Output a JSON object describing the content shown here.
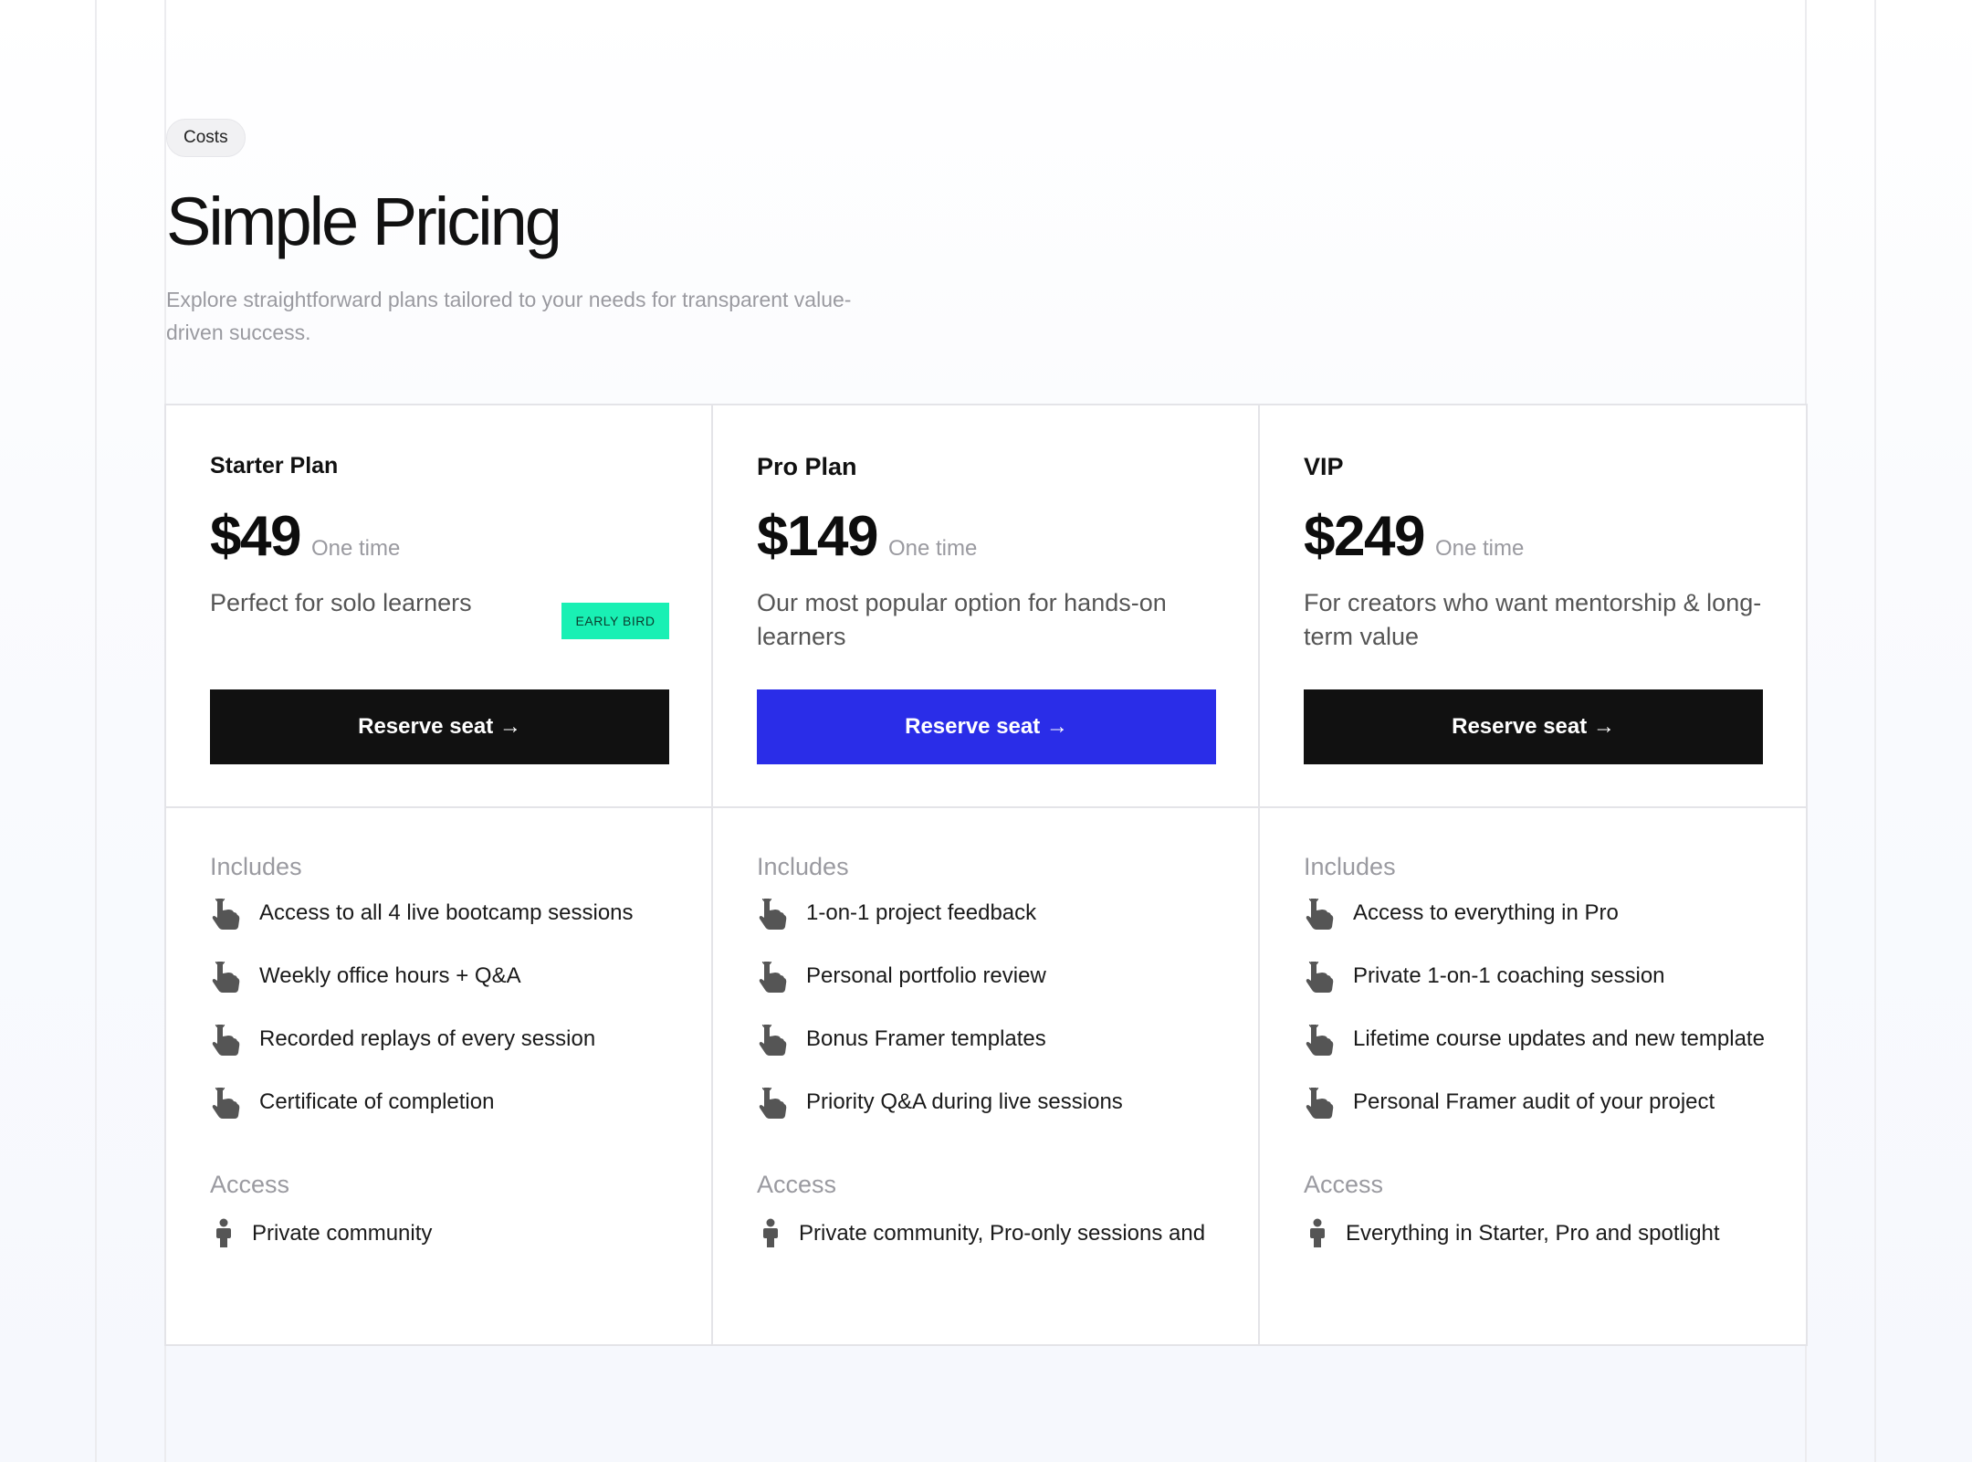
{
  "header": {
    "tag": "Costs",
    "title": "Simple Pricing",
    "subtitle": "Explore straightforward plans tailored to your needs for transparent value-driven success."
  },
  "labels": {
    "includes": "Includes",
    "access": "Access"
  },
  "colors": {
    "primary_cta": "#111111",
    "highlight_cta": "#2a2de8",
    "badge": "#19f0b4"
  },
  "icons": {
    "feature": "pointing-hand-icon",
    "access": "person-icon"
  },
  "plans": [
    {
      "name": "Starter Plan",
      "price": "$49",
      "period": "One time",
      "description": "Perfect for solo learners",
      "badge": "EARLY BIRD",
      "cta": "Reserve seat →",
      "includes": [
        "Access to all 4 live bootcamp sessions",
        "Weekly office hours + Q&A",
        "Recorded replays of every session",
        "Certificate of completion"
      ],
      "access": "Private community"
    },
    {
      "name": "Pro Plan",
      "price": "$149",
      "period": "One time",
      "description": "Our most popular option for hands-on learners",
      "cta": "Reserve seat →",
      "includes": [
        "1-on-1 project feedback",
        "Personal portfolio review",
        "Bonus Framer templates",
        "Priority Q&A during live sessions"
      ],
      "access": "Private community, Pro-only sessions and"
    },
    {
      "name": "VIP",
      "price": "$249",
      "period": "One time",
      "description": "For creators who want mentorship & long-term value",
      "cta": "Reserve seat →",
      "includes": [
        "Access to everything in Pro",
        "Private 1-on-1 coaching session",
        "Lifetime course updates and new templates",
        "Personal Framer audit of your project"
      ],
      "access": "Everything in Starter, Pro and spotlight"
    }
  ]
}
